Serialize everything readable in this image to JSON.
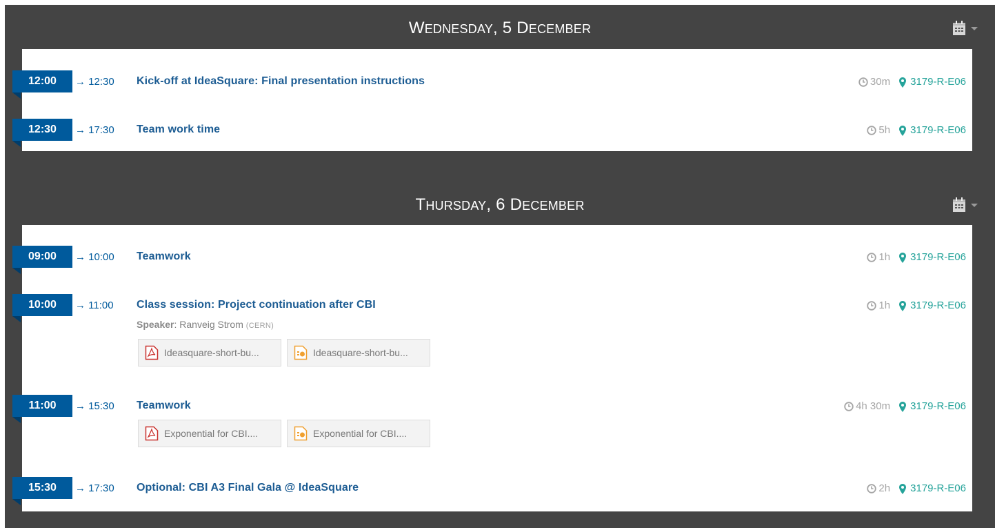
{
  "days": [
    {
      "title_first": "W",
      "title_rest": "EDNESDAY",
      "title_num": "5",
      "title_month_first": "D",
      "title_month_rest": "ECEMBER",
      "entries": [
        {
          "start": "12:00",
          "end": "→ 12:30",
          "title": "Kick-off at IdeaSquare: Final presentation instructions",
          "duration": "30m",
          "location": "3179-R-E06"
        },
        {
          "start": "12:30",
          "end": "→ 17:30",
          "title": "Team work time",
          "duration": "5h",
          "location": "3179-R-E06"
        }
      ]
    },
    {
      "title_first": "T",
      "title_rest": "HURSDAY",
      "title_num": "6",
      "title_month_first": "D",
      "title_month_rest": "ECEMBER",
      "entries": [
        {
          "start": "09:00",
          "end": "→ 10:00",
          "title": "Teamwork",
          "duration": "1h",
          "location": "3179-R-E06"
        },
        {
          "start": "10:00",
          "end": "→ 11:00",
          "title": "Class session: Project continuation after CBI",
          "duration": "1h",
          "location": "3179-R-E06",
          "speaker_label": "Speaker",
          "speaker_name": ": Ranveig Strom",
          "speaker_affiliation": "(CERN)",
          "attachments": [
            {
              "type": "pdf",
              "name": "Ideasquare-short-bu..."
            },
            {
              "type": "slides",
              "name": "Ideasquare-short-bu..."
            }
          ]
        },
        {
          "start": "11:00",
          "end": "→ 15:30",
          "title": "Teamwork",
          "duration": "4h 30m",
          "location": "3179-R-E06",
          "attachments": [
            {
              "type": "pdf",
              "name": "Exponential for CBI...."
            },
            {
              "type": "slides",
              "name": "Exponential for CBI...."
            }
          ]
        },
        {
          "start": "15:30",
          "end": "→ 17:30",
          "title": "Optional: CBI A3 Final Gala @ IdeaSquare",
          "duration": "2h",
          "location": "3179-R-E06"
        }
      ]
    }
  ],
  "icons": {
    "calendar": "calendar-icon",
    "clock": "clock-icon",
    "location": "map-marker-icon",
    "pdf": "pdf-file-icon",
    "slides": "presentation-file-icon"
  },
  "colors": {
    "frame": "#444444",
    "flag": "#005a9c",
    "title": "#1c5c93",
    "location": "#25a39a",
    "duration": "#a5a5a5"
  }
}
